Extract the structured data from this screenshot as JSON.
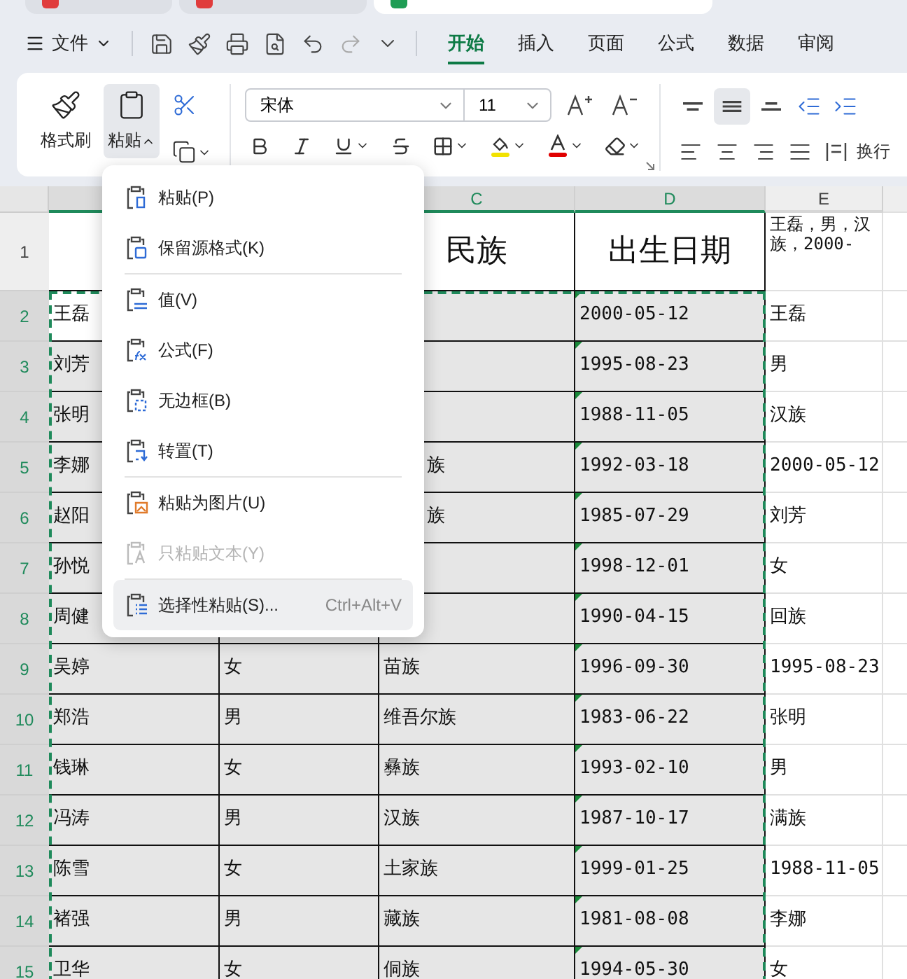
{
  "browser_tabs": [
    {
      "selected": false,
      "color": "#e03c3c"
    },
    {
      "selected": false,
      "color": "#e03c3c"
    },
    {
      "selected": true,
      "color": "#1f9d55"
    }
  ],
  "menu_bar": {
    "file_menu": "文件",
    "tabs": [
      {
        "label": "开始",
        "selected": true
      },
      {
        "label": "插入",
        "selected": false
      },
      {
        "label": "页面",
        "selected": false
      },
      {
        "label": "公式",
        "selected": false
      },
      {
        "label": "数据",
        "selected": false
      },
      {
        "label": "审阅",
        "selected": false
      }
    ]
  },
  "ribbon": {
    "format_painter": "格式刷",
    "paste_button": {
      "label": "粘贴",
      "expanded": true
    },
    "font_name": "宋体",
    "font_size": "11",
    "vertical_align": [
      {
        "selected": false
      },
      {
        "selected": true
      },
      {
        "selected": false
      }
    ],
    "wrap_label": "换行"
  },
  "sheet": {
    "columns": [
      {
        "selected": true
      },
      {},
      {
        "label": "C",
        "selected": true
      },
      {
        "label": "D",
        "selected": true
      },
      {
        "label": "E",
        "selected": false
      }
    ],
    "rows": [
      {
        "header": "1",
        "selected": false,
        "cells": [
          null,
          null,
          "民族",
          "出生日期",
          "王磊，男，汉族，2000-"
        ]
      },
      {
        "header": "2",
        "selected": true,
        "cells": [
          {
            "text": "王磊",
            "active": true
          },
          null,
          null,
          "2000-05-12",
          "王磊"
        ]
      },
      {
        "header": "3",
        "selected": true,
        "cells": [
          "刘芳",
          null,
          null,
          "1995-08-23",
          "男"
        ]
      },
      {
        "header": "4",
        "selected": true,
        "cells": [
          "张明",
          null,
          null,
          "1988-11-05",
          "汉族"
        ]
      },
      {
        "header": "5",
        "selected": true,
        "cells": [
          "李娜",
          null,
          "族",
          "1992-03-18",
          "2000-05-12"
        ]
      },
      {
        "header": "6",
        "selected": true,
        "cells": [
          "赵阳",
          null,
          "族",
          "1985-07-29",
          "刘芳"
        ]
      },
      {
        "header": "7",
        "selected": true,
        "cells": [
          "孙悦",
          null,
          null,
          "1998-12-01",
          "女"
        ]
      },
      {
        "header": "8",
        "selected": true,
        "cells": [
          "周健",
          null,
          null,
          "1990-04-15",
          "回族"
        ]
      },
      {
        "header": "9",
        "selected": true,
        "cells": [
          "吴婷",
          "女",
          "苗族",
          "1996-09-30",
          "1995-08-23"
        ]
      },
      {
        "header": "10",
        "selected": true,
        "cells": [
          "郑浩",
          "男",
          "维吾尔族",
          "1983-06-22",
          "张明"
        ]
      },
      {
        "header": "11",
        "selected": true,
        "cells": [
          "钱琳",
          "女",
          "彝族",
          "1993-02-10",
          "男"
        ]
      },
      {
        "header": "12",
        "selected": true,
        "cells": [
          "冯涛",
          "男",
          "汉族",
          "1987-10-17",
          "满族"
        ]
      },
      {
        "header": "13",
        "selected": true,
        "cells": [
          "陈雪",
          "女",
          "土家族",
          "1999-01-25",
          "1988-11-05"
        ]
      },
      {
        "header": "14",
        "selected": true,
        "cells": [
          "褚强",
          "男",
          "藏族",
          "1981-08-08",
          "李娜"
        ]
      },
      {
        "header": "15",
        "selected": true,
        "cells": [
          "卫华",
          "女",
          "侗族",
          "1994-05-30",
          "女"
        ]
      }
    ]
  },
  "context_menu": {
    "items": [
      {
        "kind": "item",
        "label": "粘贴(P)",
        "disabled": false,
        "selected": false
      },
      {
        "kind": "item",
        "label": "保留源格式(K)",
        "disabled": false,
        "selected": false
      },
      {
        "kind": "separator"
      },
      {
        "kind": "item",
        "label": "值(V)",
        "disabled": false,
        "selected": false
      },
      {
        "kind": "item",
        "label": "公式(F)",
        "disabled": false,
        "selected": false
      },
      {
        "kind": "item",
        "label": "无边框(B)",
        "disabled": false,
        "selected": false
      },
      {
        "kind": "item",
        "label": "转置(T)",
        "disabled": false,
        "selected": false
      },
      {
        "kind": "separator"
      },
      {
        "kind": "item",
        "label": "粘贴为图片(U)",
        "disabled": false,
        "selected": false
      },
      {
        "kind": "item",
        "label": "只粘贴文本(Y)",
        "disabled": true,
        "selected": false
      },
      {
        "kind": "separator"
      },
      {
        "kind": "item",
        "label": "选择性粘贴(S)...",
        "shortcut": "Ctrl+Alt+V",
        "disabled": false,
        "selected": true
      }
    ]
  }
}
